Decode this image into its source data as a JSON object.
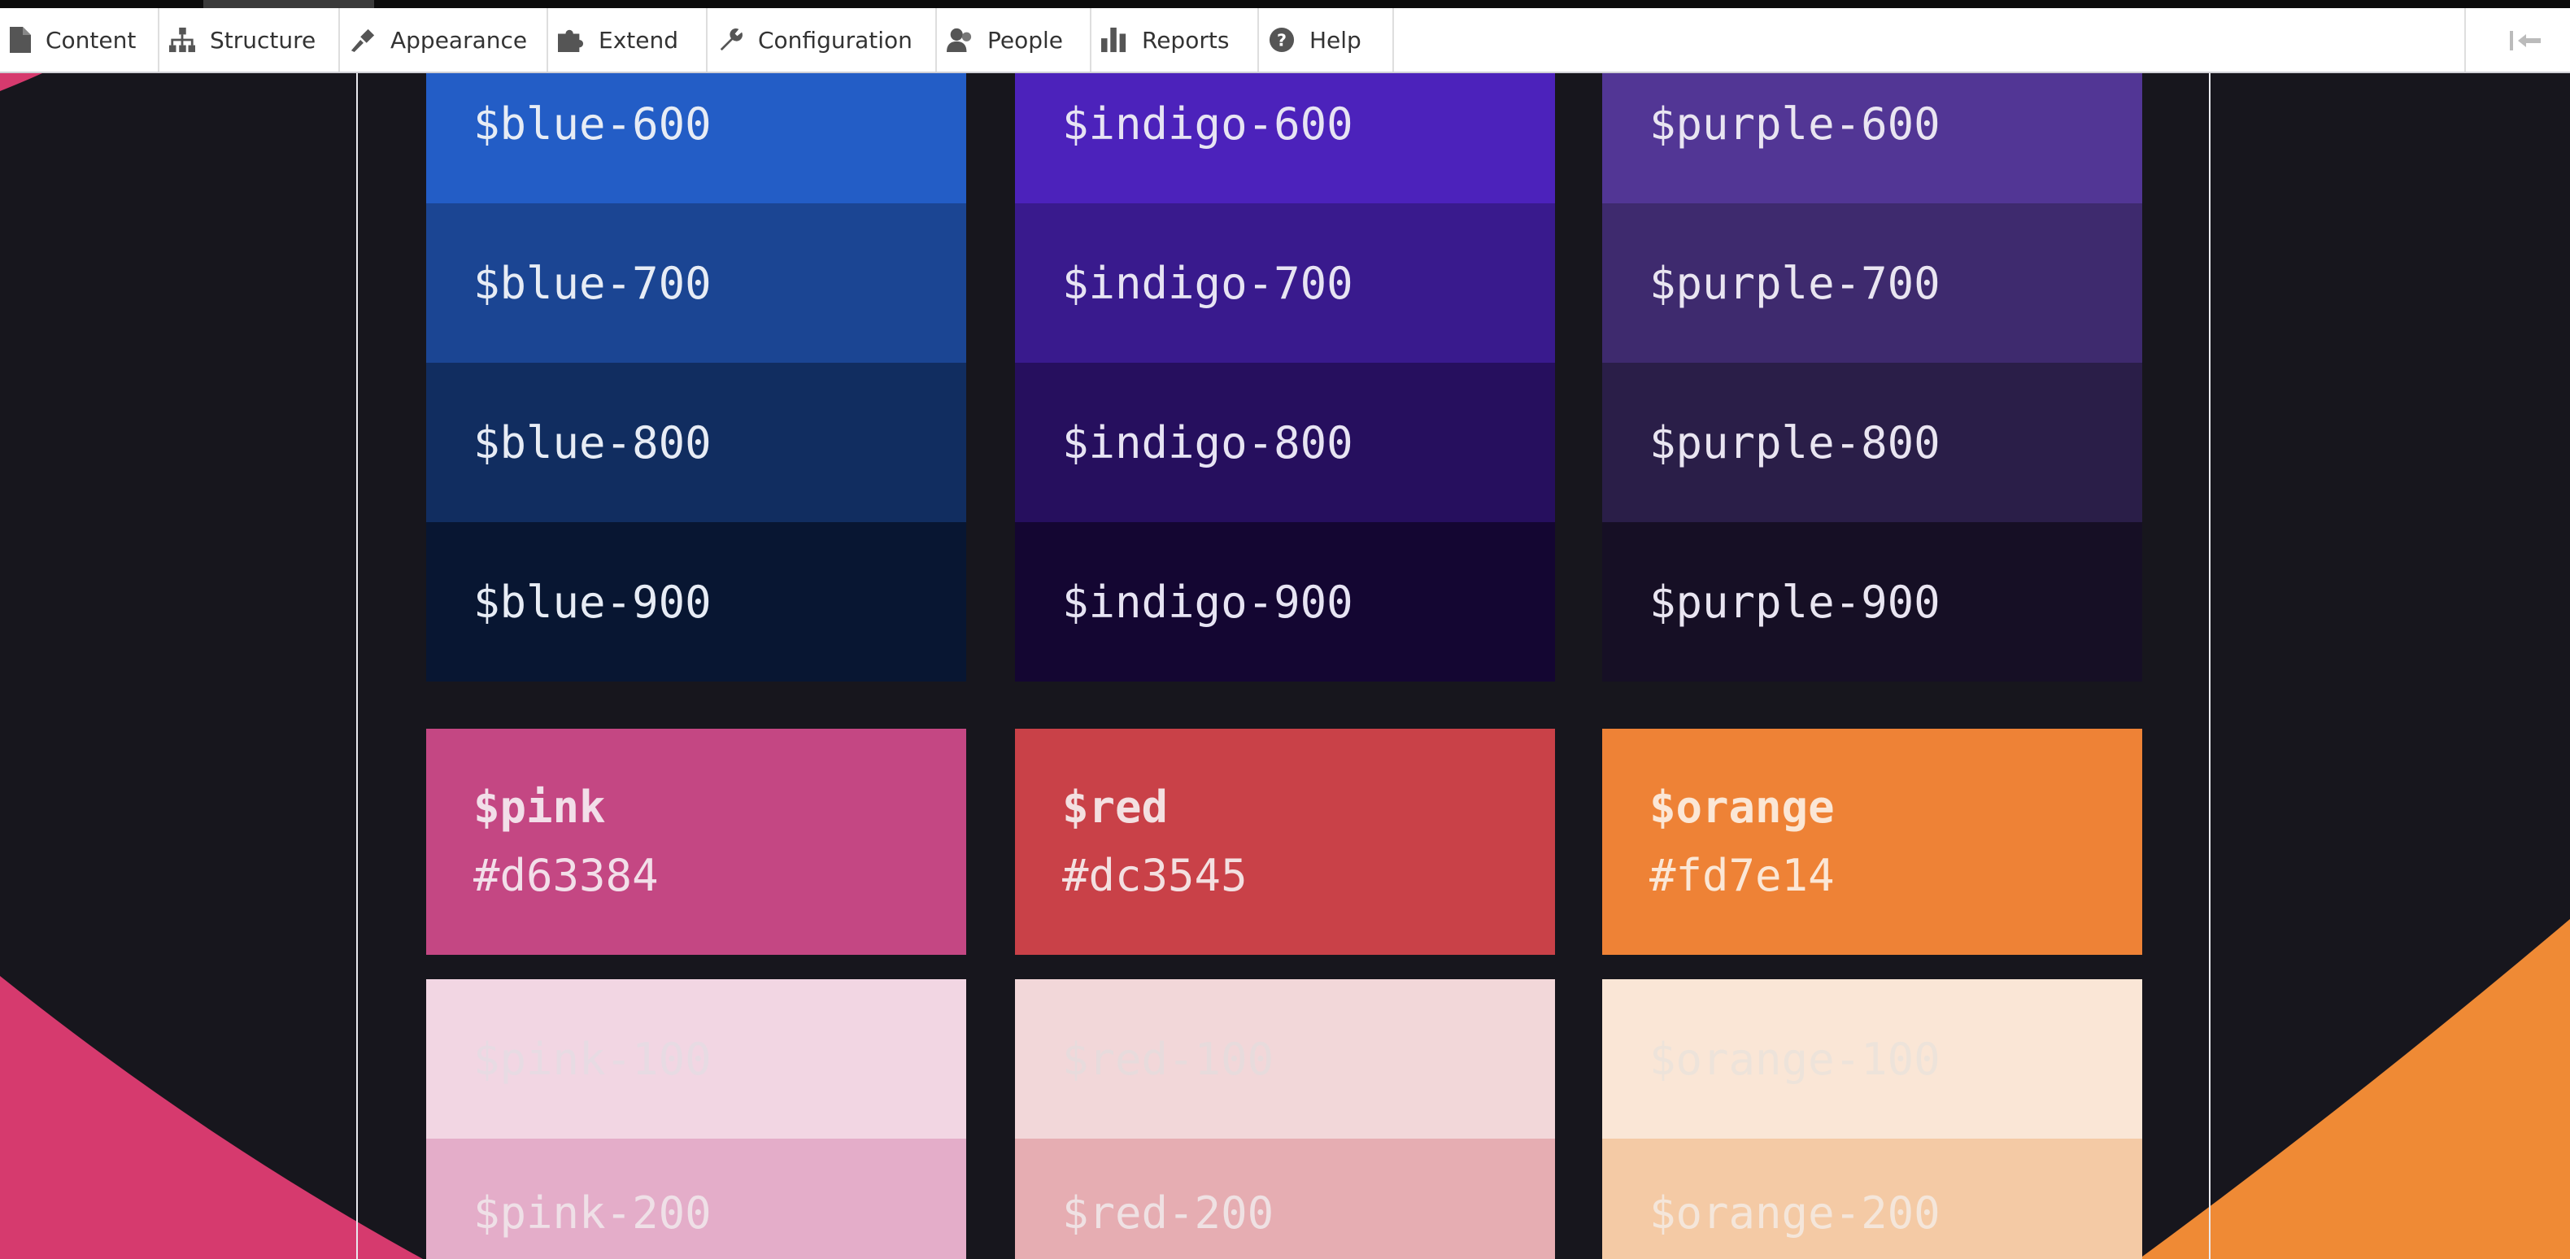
{
  "toolbar": {
    "items": [
      {
        "label": "Content",
        "icon": "file-icon"
      },
      {
        "label": "Structure",
        "icon": "sitemap-icon"
      },
      {
        "label": "Appearance",
        "icon": "paintbrush-icon"
      },
      {
        "label": "Extend",
        "icon": "puzzle-icon"
      },
      {
        "label": "Configuration",
        "icon": "wrench-icon"
      },
      {
        "label": "People",
        "icon": "people-icon"
      },
      {
        "label": "Reports",
        "icon": "bar-chart-icon"
      },
      {
        "label": "Help",
        "icon": "help-icon"
      }
    ],
    "orientation_toggle_icon": "orientation-toggle-icon"
  },
  "colors": {
    "page_background": "#17161d",
    "pink_curve": "#d63384",
    "orange_curve": "#fd7e14"
  },
  "swatches": {
    "blue": [
      {
        "label": "$blue-600",
        "bg": "#235dc6",
        "fg": "#e7ecf5"
      },
      {
        "label": "$blue-700",
        "bg": "#1b4593",
        "fg": "#e7ecf5"
      },
      {
        "label": "$blue-800",
        "bg": "#112d60",
        "fg": "#e7ecf5"
      },
      {
        "label": "$blue-900",
        "bg": "#081632",
        "fg": "#e7ecf5"
      }
    ],
    "indigo": [
      {
        "label": "$indigo-600",
        "bg": "#4c22bb",
        "fg": "#e7e4f3"
      },
      {
        "label": "$indigo-700",
        "bg": "#391a8d",
        "fg": "#e7e4f3"
      },
      {
        "label": "$indigo-800",
        "bg": "#260f5e",
        "fg": "#e7e4f3"
      },
      {
        "label": "$indigo-900",
        "bg": "#140632",
        "fg": "#e7e4f3"
      }
    ],
    "purple": [
      {
        "label": "$purple-600",
        "bg": "#523695",
        "fg": "#e9e5f1"
      },
      {
        "label": "$purple-700",
        "bg": "#3e2a6e",
        "fg": "#e9e5f1"
      },
      {
        "label": "$purple-800",
        "bg": "#2a1e48",
        "fg": "#e9e5f1"
      },
      {
        "label": "$purple-900",
        "bg": "#160f25",
        "fg": "#e9e5f1"
      }
    ],
    "pink": {
      "main": {
        "name": "$pink",
        "hex": "#d63384",
        "bg": "#c44783",
        "fg": "#f2dfe9"
      },
      "shades": [
        {
          "label": "$pink-100",
          "bg": "#f2d6e3",
          "fg": "#e7dbe3"
        },
        {
          "label": "$pink-200",
          "bg": "#e4adc9",
          "fg": "#efe0e7"
        }
      ]
    },
    "red": {
      "main": {
        "name": "$red",
        "hex": "#dc3545",
        "bg": "#c94148",
        "fg": "#f3e0e1"
      },
      "shades": [
        {
          "label": "$red-100",
          "bg": "#f2d7d9",
          "fg": "#e7dbdc"
        },
        {
          "label": "$red-200",
          "bg": "#e6adb2",
          "fg": "#efe1e3"
        }
      ]
    },
    "orange": {
      "main": {
        "name": "$orange",
        "hex": "#fd7e14",
        "bg": "#ee8236",
        "fg": "#fbe7d6"
      },
      "shades": [
        {
          "label": "$orange-100",
          "bg": "#fae6d6",
          "fg": "#ede3da"
        },
        {
          "label": "$orange-200",
          "bg": "#f4caa5",
          "fg": "#f4e6da"
        }
      ]
    }
  }
}
